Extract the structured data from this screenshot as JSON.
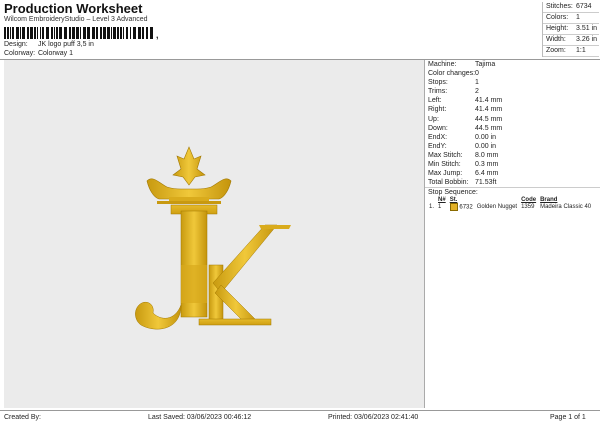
{
  "header": {
    "title": "Production Worksheet",
    "subtitle": "Wilcom EmbroideryStudio – Level 3 Advanced",
    "barcode_suffix": ","
  },
  "design_info": {
    "design_label": "Design:",
    "design_value": "JK logo puff 3,5 in",
    "colorway_label": "Colorway:",
    "colorway_value": "Colorway 1"
  },
  "top_stats": [
    {
      "label": "Stitches:",
      "value": "6734"
    },
    {
      "label": "Colors:",
      "value": "1"
    },
    {
      "label": "Height:",
      "value": "3.51 in"
    },
    {
      "label": "Width:",
      "value": "3.26 in"
    },
    {
      "label": "Zoom:",
      "value": "1:1"
    }
  ],
  "machine_info": [
    {
      "label": "Machine:",
      "value": "Tajima"
    },
    {
      "label": "Color changes:",
      "value": "0"
    },
    {
      "label": "Stops:",
      "value": "1"
    },
    {
      "label": "Trims:",
      "value": "2"
    },
    {
      "label": "Left:",
      "value": "41.4 mm"
    },
    {
      "label": "Right:",
      "value": "41.4 mm"
    },
    {
      "label": "Up:",
      "value": "44.5 mm"
    },
    {
      "label": "Down:",
      "value": "44.5 mm"
    },
    {
      "label": "EndX:",
      "value": "0.00 in"
    },
    {
      "label": "EndY:",
      "value": "0.00 in"
    },
    {
      "label": "Max Stitch:",
      "value": "8.0 mm"
    },
    {
      "label": "Min Stitch:",
      "value": "0.3 mm"
    },
    {
      "label": "Max Jump:",
      "value": "6.4 mm"
    },
    {
      "label": "Total Bobbin:",
      "value": "71.53ft"
    }
  ],
  "stop_sequence": {
    "heading": "Stop Sequence:",
    "columns": [
      "",
      "N#",
      "St.",
      "Code",
      "Brand"
    ],
    "rows": [
      {
        "num": "1.",
        "n": "1",
        "st": "6732",
        "name": "Golden Nugget",
        "code": "1359",
        "brand": "Madeira Classic 40",
        "color": "#e3b126"
      }
    ]
  },
  "footer": {
    "created_by": "Created By:",
    "last_saved": "Last Saved: 03/06/2023 00:46:12",
    "printed": "Printed: 03/06/2023 02:41:40",
    "page": "Page 1 of 1"
  },
  "colors": {
    "thread": "#e3b126",
    "canvas": "#ebebeb"
  }
}
